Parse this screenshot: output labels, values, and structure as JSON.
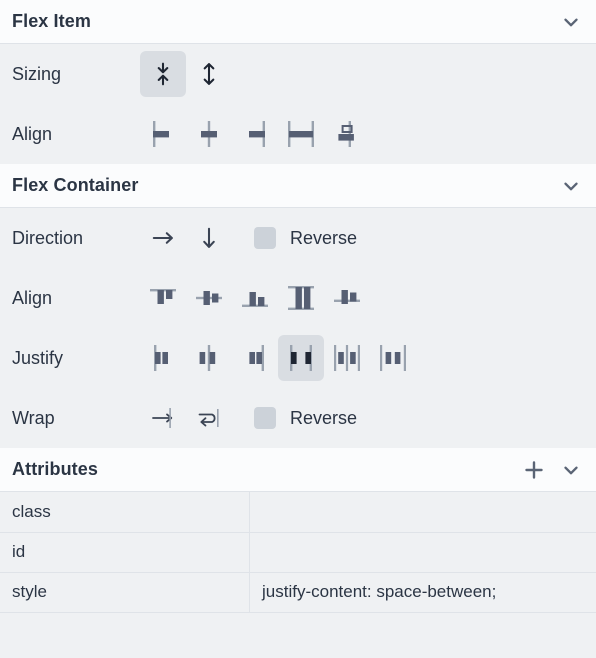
{
  "sections": {
    "flex_item": {
      "title": "Flex Item",
      "collapse_icon": "chevron-down-icon",
      "rows": [
        {
          "label": "Sizing",
          "buttons": [
            {
              "icon": "fit-content-icon",
              "selected": true
            },
            {
              "icon": "fill-space-icon",
              "selected": false
            }
          ]
        },
        {
          "label": "Align",
          "buttons": [
            {
              "icon": "align-self-flex-start-icon",
              "selected": false
            },
            {
              "icon": "align-self-center-icon",
              "selected": false
            },
            {
              "icon": "align-self-flex-end-icon",
              "selected": false
            },
            {
              "icon": "align-self-stretch-icon",
              "selected": false
            },
            {
              "icon": "align-self-baseline-icon",
              "selected": false
            }
          ]
        }
      ]
    },
    "flex_container": {
      "title": "Flex Container",
      "collapse_icon": "chevron-down-icon",
      "rows": [
        {
          "label": "Direction",
          "buttons": [
            {
              "icon": "direction-row-icon",
              "selected": false
            },
            {
              "icon": "direction-column-icon",
              "selected": false
            }
          ],
          "checkbox": {
            "label": "Reverse",
            "checked": false
          }
        },
        {
          "label": "Align",
          "buttons": [
            {
              "icon": "align-items-flex-start-icon",
              "selected": false
            },
            {
              "icon": "align-items-center-icon",
              "selected": false
            },
            {
              "icon": "align-items-flex-end-icon",
              "selected": false
            },
            {
              "icon": "align-items-stretch-icon",
              "selected": false
            },
            {
              "icon": "align-items-baseline-icon",
              "selected": false
            }
          ]
        },
        {
          "label": "Justify",
          "buttons": [
            {
              "icon": "justify-flex-start-icon",
              "selected": false
            },
            {
              "icon": "justify-center-icon",
              "selected": false
            },
            {
              "icon": "justify-flex-end-icon",
              "selected": false
            },
            {
              "icon": "justify-space-between-icon",
              "selected": true
            },
            {
              "icon": "justify-space-around-icon",
              "selected": false
            },
            {
              "icon": "justify-space-evenly-icon",
              "selected": false
            }
          ]
        },
        {
          "label": "Wrap",
          "buttons": [
            {
              "icon": "nowrap-icon",
              "selected": false
            },
            {
              "icon": "wrap-icon",
              "selected": false
            }
          ],
          "checkbox": {
            "label": "Reverse",
            "checked": false
          }
        }
      ]
    },
    "attributes": {
      "title": "Attributes",
      "add_icon": "plus-icon",
      "collapse_icon": "chevron-down-icon",
      "rows": [
        {
          "name": "class",
          "value": ""
        },
        {
          "name": "id",
          "value": ""
        },
        {
          "name": "style",
          "value": "justify-content: space-between;"
        }
      ]
    }
  },
  "colors": {
    "panel_bg": "#eff1f3",
    "header_bg": "#fbfcfd",
    "border": "#dfe3e8",
    "text": "#2b3544",
    "icon": "#565f73",
    "icon_dark": "#1f2633",
    "guide": "#99a2ae",
    "selected_bg": "#d9dde2",
    "checkbox_bg": "#ccd2d9"
  }
}
